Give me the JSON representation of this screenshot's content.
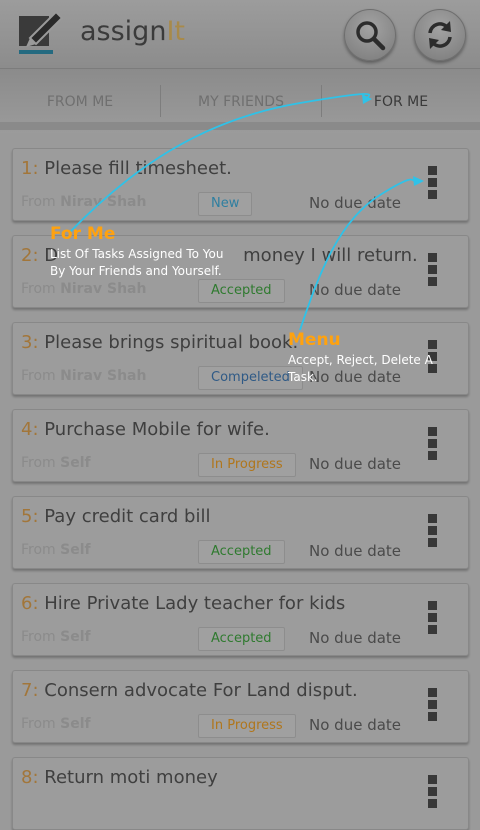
{
  "app": {
    "title_main": "assign",
    "title_accent": "It",
    "icons": [
      "pen-logo-icon",
      "search-icon",
      "refresh-icon"
    ]
  },
  "tabs": [
    {
      "label": "FROM ME"
    },
    {
      "label": "MY FRIENDS"
    },
    {
      "label": "FOR ME",
      "active": true
    }
  ],
  "tasks": [
    {
      "num": "1:",
      "title": "Please fill timesheet.",
      "from_label": "From",
      "from": "Nirav Shah",
      "status": "New",
      "status_color": "#2f7fa0",
      "due": "No due date"
    },
    {
      "num": "2:",
      "title": "D",
      "title_tail": "money I will return.",
      "from_label": "From",
      "from": "Nirav Shah",
      "status": "Accepted",
      "status_color": "#2f7a2f",
      "due": "No due date"
    },
    {
      "num": "3:",
      "title": "Please brings spiritual book.",
      "from_label": "From",
      "from": "Nirav Shah",
      "status": "Compeleted",
      "status_color": "#2f5a86",
      "due": "No due date"
    },
    {
      "num": "4:",
      "title": "Purchase Mobile for wife.",
      "from_label": "From",
      "from": "Self",
      "status": "In Progress",
      "status_color": "#b0761c",
      "due": "No due date"
    },
    {
      "num": "5:",
      "title": "Pay credit card bill",
      "from_label": "From",
      "from": "Self",
      "status": "Accepted",
      "status_color": "#2f7a2f",
      "due": "No due date"
    },
    {
      "num": "6:",
      "title": "Hire Private Lady teacher for kids",
      "from_label": "From",
      "from": "Self",
      "status": "Accepted",
      "status_color": "#2f7a2f",
      "due": "No due date"
    },
    {
      "num": "7:",
      "title": "Consern advocate For Land disput.",
      "from_label": "From",
      "from": "Self",
      "status": "In Progress",
      "status_color": "#b0761c",
      "due": "No due date"
    },
    {
      "num": "8:",
      "title": "Return moti money",
      "from_label": "",
      "from": "",
      "status": "",
      "status_color": "",
      "due": ""
    }
  ],
  "hints": {
    "for_me": {
      "heading": "For Me",
      "text": "List Of Tasks Assigned To You By Your Friends and Yourself."
    },
    "menu": {
      "heading": "Menu",
      "text": "Accept, Reject, Delete A Task."
    }
  },
  "colors": {
    "accent": "#ffa20f",
    "tab_indicator": "#246a80",
    "arrow": "#2fc2e8"
  }
}
